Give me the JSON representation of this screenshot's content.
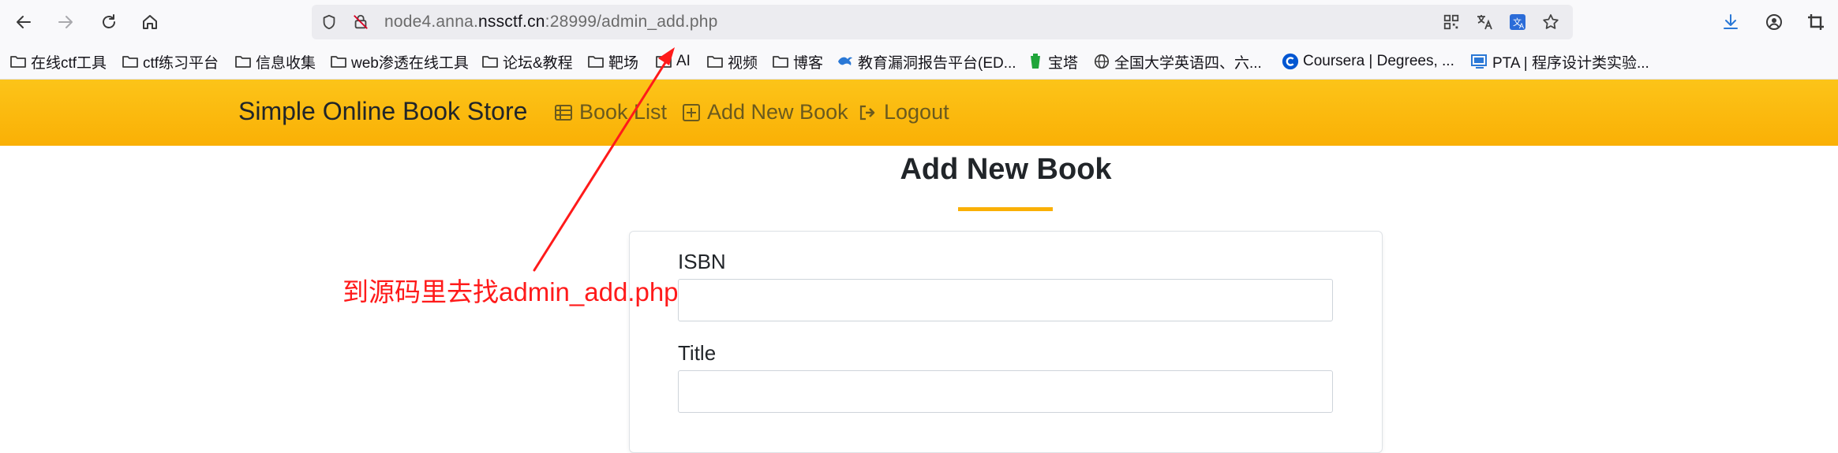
{
  "browser": {
    "url_prefix": "node4.anna.",
    "url_domain": "nssctf.cn",
    "url_suffix": ":28999/admin_add.php",
    "bookmarks": [
      {
        "label": "在线ctf工具",
        "icon": "folder-icon"
      },
      {
        "label": "ctf练习平台",
        "icon": "folder-icon"
      },
      {
        "label": "信息收集",
        "icon": "folder-icon"
      },
      {
        "label": "web渗透在线工具",
        "icon": "folder-icon"
      },
      {
        "label": "论坛&教程",
        "icon": "folder-icon"
      },
      {
        "label": "靶场",
        "icon": "folder-icon"
      },
      {
        "label": "AI",
        "icon": "folder-icon"
      },
      {
        "label": "视频",
        "icon": "folder-icon"
      },
      {
        "label": "博客",
        "icon": "folder-icon"
      },
      {
        "label": "教育漏洞报告平台(ED...",
        "icon": "edu-site-icon"
      },
      {
        "label": "宝塔",
        "icon": "baota-icon"
      },
      {
        "label": "全国大学英语四、六...",
        "icon": "globe-icon"
      },
      {
        "label": "Coursera | Degrees, ...",
        "icon": "coursera-icon"
      },
      {
        "label": "PTA | 程序设计类实验...",
        "icon": "pta-icon"
      }
    ]
  },
  "site": {
    "brand": "Simple Online Book Store",
    "nav": [
      {
        "label": "Book List",
        "icon": "table-list-icon"
      },
      {
        "label": "Add New Book",
        "icon": "plus-square-icon"
      },
      {
        "label": "Logout",
        "icon": "sign-out-icon"
      }
    ]
  },
  "page": {
    "title": "Add New Book",
    "fields": [
      {
        "label": "ISBN",
        "value": ""
      },
      {
        "label": "Title",
        "value": ""
      }
    ]
  },
  "annotation": {
    "text": "到源码里去找admin_add.php",
    "color": "#ff1a1a"
  },
  "colors": {
    "navbar": "#fcc419",
    "accent": "#fab005"
  }
}
